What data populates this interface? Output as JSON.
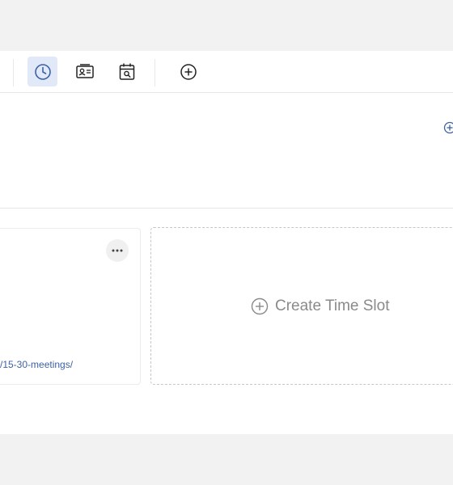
{
  "toolbar": {
    "buttons": [
      {
        "icon": "clock-icon",
        "active": true
      },
      {
        "icon": "contact-card-icon",
        "active": false
      },
      {
        "icon": "calendar-search-icon",
        "active": false
      },
      {
        "icon": "add-circle-icon",
        "active": false
      }
    ]
  },
  "card": {
    "link_text": "/15-30-meetings/",
    "more_icon": "ellipsis-icon"
  },
  "create_slot": {
    "label": "Create Time Slot",
    "icon": "add-circle-icon"
  },
  "colors": {
    "accent": "#3c62a5",
    "active_bg": "#e1e9f8",
    "page_bg": "#f2f2f2"
  }
}
